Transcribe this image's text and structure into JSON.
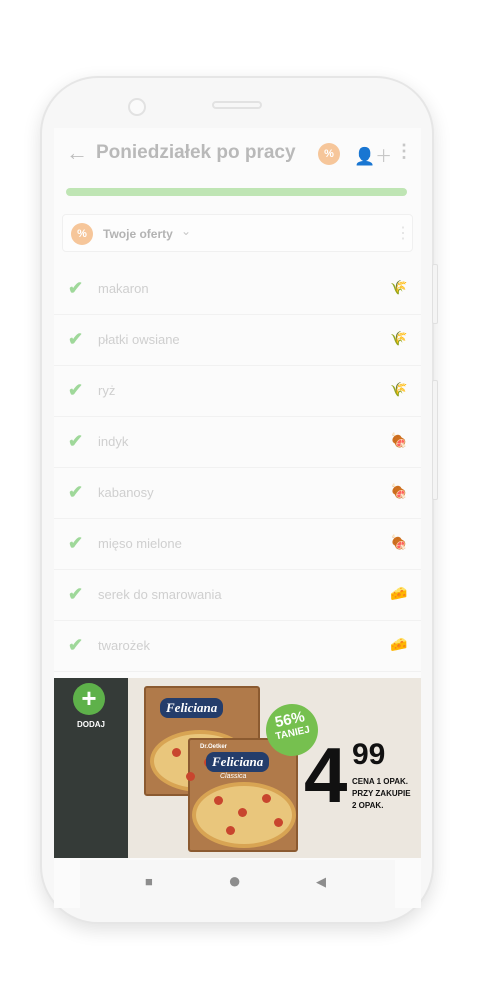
{
  "app": {
    "title": "Poniedziałek po pracy",
    "progress": 1.0
  },
  "appbar": {
    "back_icon": "arrow-left-icon",
    "promo_icon_text": "%",
    "share_icon": "person-add-icon",
    "menu_icon": "more-vert-icon"
  },
  "offers": {
    "label": "Twoje oferty",
    "icon_text": "%"
  },
  "items": [
    {
      "label": "makaron",
      "checked": true,
      "category_icon": "grain-icon"
    },
    {
      "label": "płatki owsiane",
      "checked": true,
      "category_icon": "grain-icon"
    },
    {
      "label": "ryż",
      "checked": true,
      "category_icon": "grain-icon"
    },
    {
      "label": "indyk",
      "checked": true,
      "category_icon": "meat-icon"
    },
    {
      "label": "kabanosy",
      "checked": true,
      "category_icon": "meat-icon"
    },
    {
      "label": "mięso mielone",
      "checked": true,
      "category_icon": "meat-icon"
    },
    {
      "label": "serek do smarowania",
      "checked": true,
      "category_icon": "cheese-icon"
    },
    {
      "label": "twarożek",
      "checked": true,
      "category_icon": "cheese-icon"
    }
  ],
  "fab": {
    "label": "DODAJ"
  },
  "banner": {
    "brand_top": "Dr.Oetker",
    "brand": "Feliciana",
    "brand_sub": "Classica",
    "discount_pct": "56%",
    "discount_word": "TANIEJ",
    "price_int": "4",
    "price_dec": "99",
    "price_note_1": "CENA 1 OPAK.",
    "price_note_2": "PRZY ZAKUPIE",
    "price_note_3": "2 OPAK."
  },
  "navbar": {
    "recents": "■",
    "home": "●",
    "back": "◀"
  },
  "colors": {
    "accent_green": "#5eb14a",
    "check_green": "#9fd89a",
    "promo_orange": "#f6c69a",
    "dark_panel": "#353b38"
  }
}
